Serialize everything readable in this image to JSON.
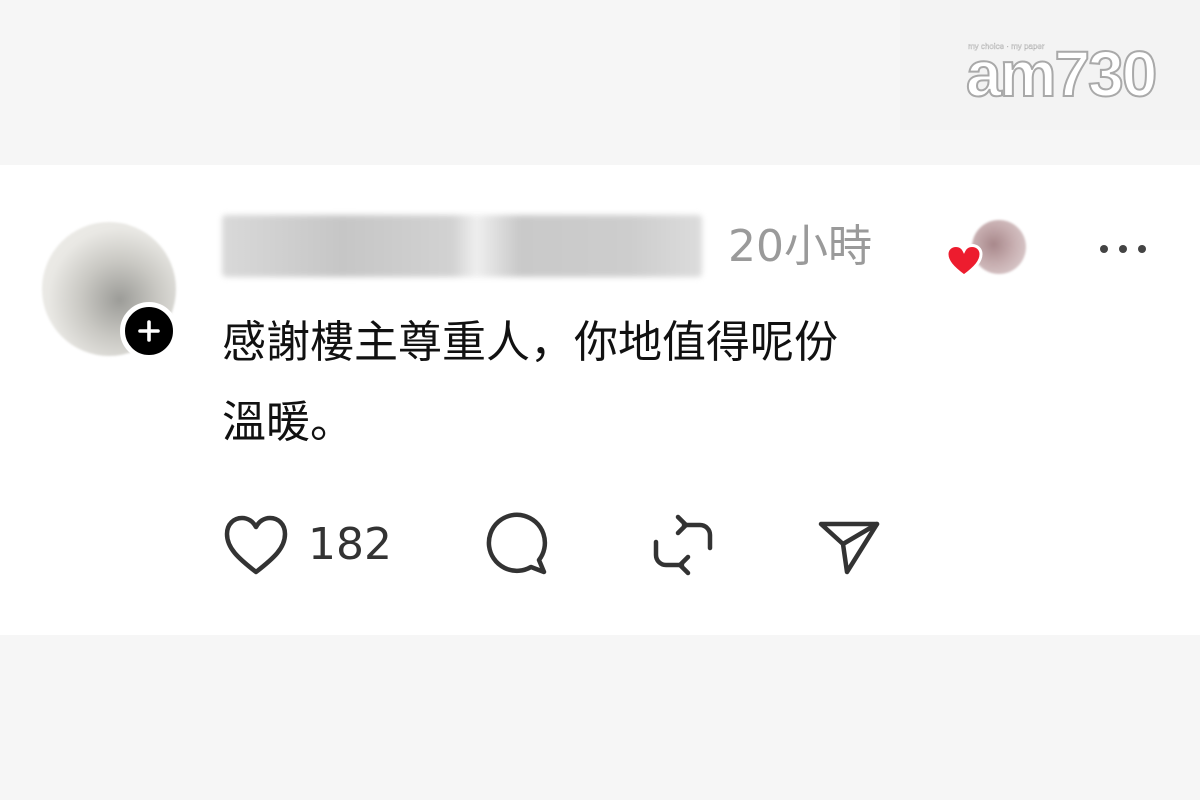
{
  "watermark": {
    "tagline": "my choice · my paper",
    "brand": "am730"
  },
  "post": {
    "timestamp": "20小時",
    "text_lines": [
      "感謝樓主尊重人，你地值得呢份",
      "溫暖。"
    ],
    "likes": "182"
  },
  "icons": {
    "follow": "plus-icon",
    "reaction": "heart-icon",
    "more": "more-dots-icon",
    "like": "heart-outline-icon",
    "reply": "comment-icon",
    "repost": "repost-icon",
    "share": "send-icon"
  },
  "colors": {
    "heart": "#ed1c2e",
    "timestamp": "#9a9a9a",
    "text": "#111111",
    "icon": "#333333"
  }
}
